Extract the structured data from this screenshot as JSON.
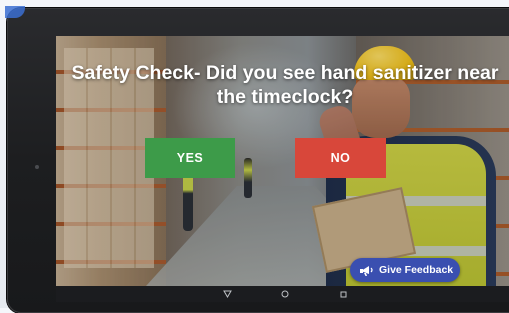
{
  "prompt": {
    "question": "Safety Check- Did you see hand sanitizer near the timeclock?"
  },
  "answers": {
    "yes_label": "YES",
    "no_label": "NO"
  },
  "feedback": {
    "label": "Give Feedback",
    "icon": "megaphone-icon"
  },
  "navbar": {
    "back_icon": "triangle-back-icon",
    "home_icon": "circle-home-icon",
    "recents_icon": "square-recents-icon"
  },
  "colors": {
    "yes": "#3d9b49",
    "no": "#d8473a",
    "feedback": "#3a4fb0"
  }
}
